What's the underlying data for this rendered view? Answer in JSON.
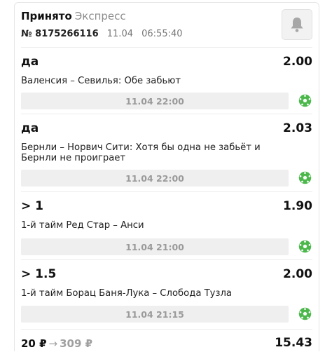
{
  "header": {
    "status": "Принято",
    "type": "Экспресс",
    "number_label": "№ 8175266116",
    "date": "11.04",
    "time": "06:55:40",
    "bell_icon": "bell-icon"
  },
  "bets": [
    {
      "pick": "да",
      "odd": "2.00",
      "event": "Валенсия – Севилья: Обе забьют",
      "datetime": "11.04 22:00",
      "sport_icon": "football-icon"
    },
    {
      "pick": "да",
      "odd": "2.03",
      "event": "Бернли – Норвич Сити: Хотя бы одна не забьёт и Бернли не проиграет",
      "datetime": "11.04 22:00",
      "sport_icon": "football-icon"
    },
    {
      "pick": "> 1",
      "odd": "1.90",
      "event": "1-й тайм Ред Стар – Анси",
      "datetime": "11.04 21:00",
      "sport_icon": "football-icon"
    },
    {
      "pick": "> 1.5",
      "odd": "2.00",
      "event": "1-й тайм Борац Баня-Лука – Слобода Тузла",
      "datetime": "11.04 21:15",
      "sport_icon": "football-icon"
    }
  ],
  "footer": {
    "stake": "20 ₽",
    "arrow": "→",
    "payout": "309 ₽",
    "total_odd": "15.43"
  },
  "colors": {
    "sport_icon": "#4cb84c",
    "muted": "#9a9a9a",
    "time_bar": "#efefef"
  }
}
